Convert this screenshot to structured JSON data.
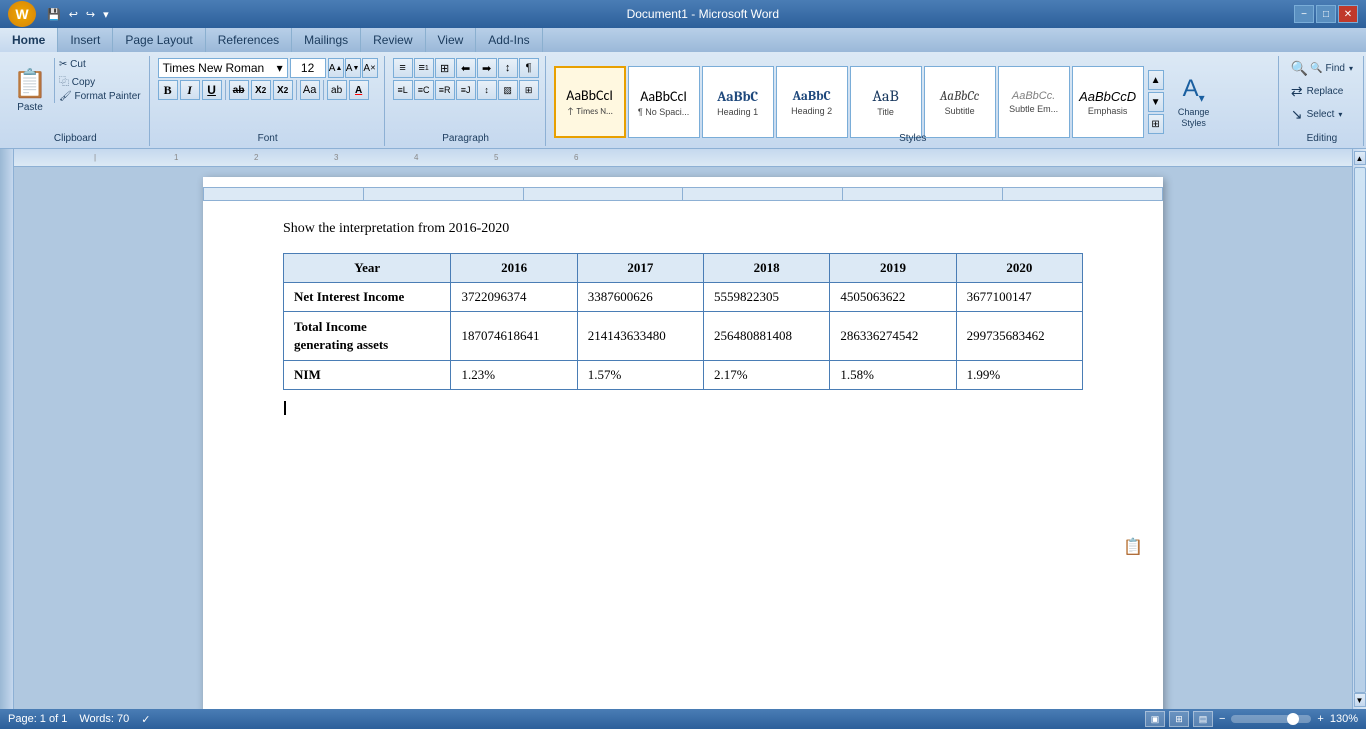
{
  "titleBar": {
    "appName": "Document1 - Microsoft Word",
    "minimize": "−",
    "maximize": "□",
    "close": "✕"
  },
  "quickAccess": {
    "save": "💾",
    "undo": "↩",
    "redo": "↪",
    "arrow": "▾"
  },
  "officeBtn": "W",
  "ribbonTabs": [
    {
      "label": "Home",
      "active": true
    },
    {
      "label": "Insert",
      "active": false
    },
    {
      "label": "Page Layout",
      "active": false
    },
    {
      "label": "References",
      "active": false
    },
    {
      "label": "Mailings",
      "active": false
    },
    {
      "label": "Review",
      "active": false
    },
    {
      "label": "View",
      "active": false
    },
    {
      "label": "Add-Ins",
      "active": false
    }
  ],
  "clipboard": {
    "paste": "Paste",
    "cut": "✂ Cut",
    "copy": "⿻ Copy",
    "formatPainter": "🖌 Format Painter",
    "groupLabel": "Clipboard",
    "expandIcon": "⬛"
  },
  "font": {
    "name": "Times New Roman",
    "size": "12",
    "growIcon": "A↑",
    "shrinkIcon": "A↓",
    "clearIcon": "A",
    "bold": "B",
    "italic": "I",
    "underline": "U",
    "strikethrough": "ab",
    "subscript": "X₂",
    "superscript": "X²",
    "changeCase": "Aa",
    "highlight": "ab",
    "fontColor": "A",
    "groupLabel": "Font",
    "expandIcon": "⬛"
  },
  "paragraph": {
    "bullets": "≡•",
    "numbering": "≡1",
    "multilevel": "≡☰",
    "decreaseIndent": "⬅≡",
    "increaseIndent": "➡≡",
    "sort": "↕A",
    "showHide": "¶",
    "alignLeft": "≡L",
    "alignCenter": "≡C",
    "alignRight": "≡R",
    "justify": "≡J",
    "lineSpacing": "↕",
    "shading": "🎨",
    "borders": "⊞",
    "groupLabel": "Paragraph",
    "expandIcon": "⬛"
  },
  "styles": {
    "items": [
      {
        "label": "¶ Times N...",
        "sublabel": "↑ Times N...",
        "type": "normal",
        "active": true
      },
      {
        "label": "¶ No Spaci...",
        "sublabel": "",
        "type": "no-spacing",
        "active": false
      },
      {
        "label": "Heading 1",
        "sublabel": "",
        "type": "h1",
        "active": false
      },
      {
        "label": "Heading 2",
        "sublabel": "",
        "type": "h2",
        "active": false
      },
      {
        "label": "Title",
        "sublabel": "",
        "type": "title",
        "active": false
      },
      {
        "label": "Subtitle",
        "sublabel": "",
        "type": "subtitle",
        "active": false
      },
      {
        "label": "Subtle Em...",
        "sublabel": "",
        "type": "subtle-em",
        "active": false
      },
      {
        "label": "Emphasis",
        "sublabel": "",
        "type": "emphasis",
        "active": false
      }
    ],
    "groupLabel": "Styles",
    "expandIcon": "⬛"
  },
  "changeStyles": {
    "label": "Change\nStyles",
    "icon": "A"
  },
  "editing": {
    "find": "🔍 Find",
    "replace": "⇄ Replace",
    "select": "↘ Select",
    "selectArrow": "▾",
    "groupLabel": "Editing"
  },
  "document": {
    "heading": "Show the interpretation from 2016-2020",
    "table": {
      "headers": [
        "Year",
        "2016",
        "2017",
        "2018",
        "2019",
        "2020"
      ],
      "rows": [
        {
          "label": "Net Interest Income",
          "values": [
            "3722096374",
            "3387600626",
            "5559822305",
            "4505063622",
            "3677100147"
          ]
        },
        {
          "label": "Total Income generating assets",
          "values": [
            "187074618641",
            "214143633480",
            "256480881408",
            "286336274542",
            "299735683462"
          ]
        },
        {
          "label": "NIM",
          "values": [
            "1.23%",
            "1.57%",
            "2.17%",
            "1.58%",
            "1.99%"
          ]
        }
      ]
    }
  },
  "statusBar": {
    "page": "Page: 1 of 1",
    "words": "Words: 70",
    "proofing": "✓",
    "zoom": "130%",
    "zoomMinus": "−",
    "zoomPlus": "+"
  }
}
